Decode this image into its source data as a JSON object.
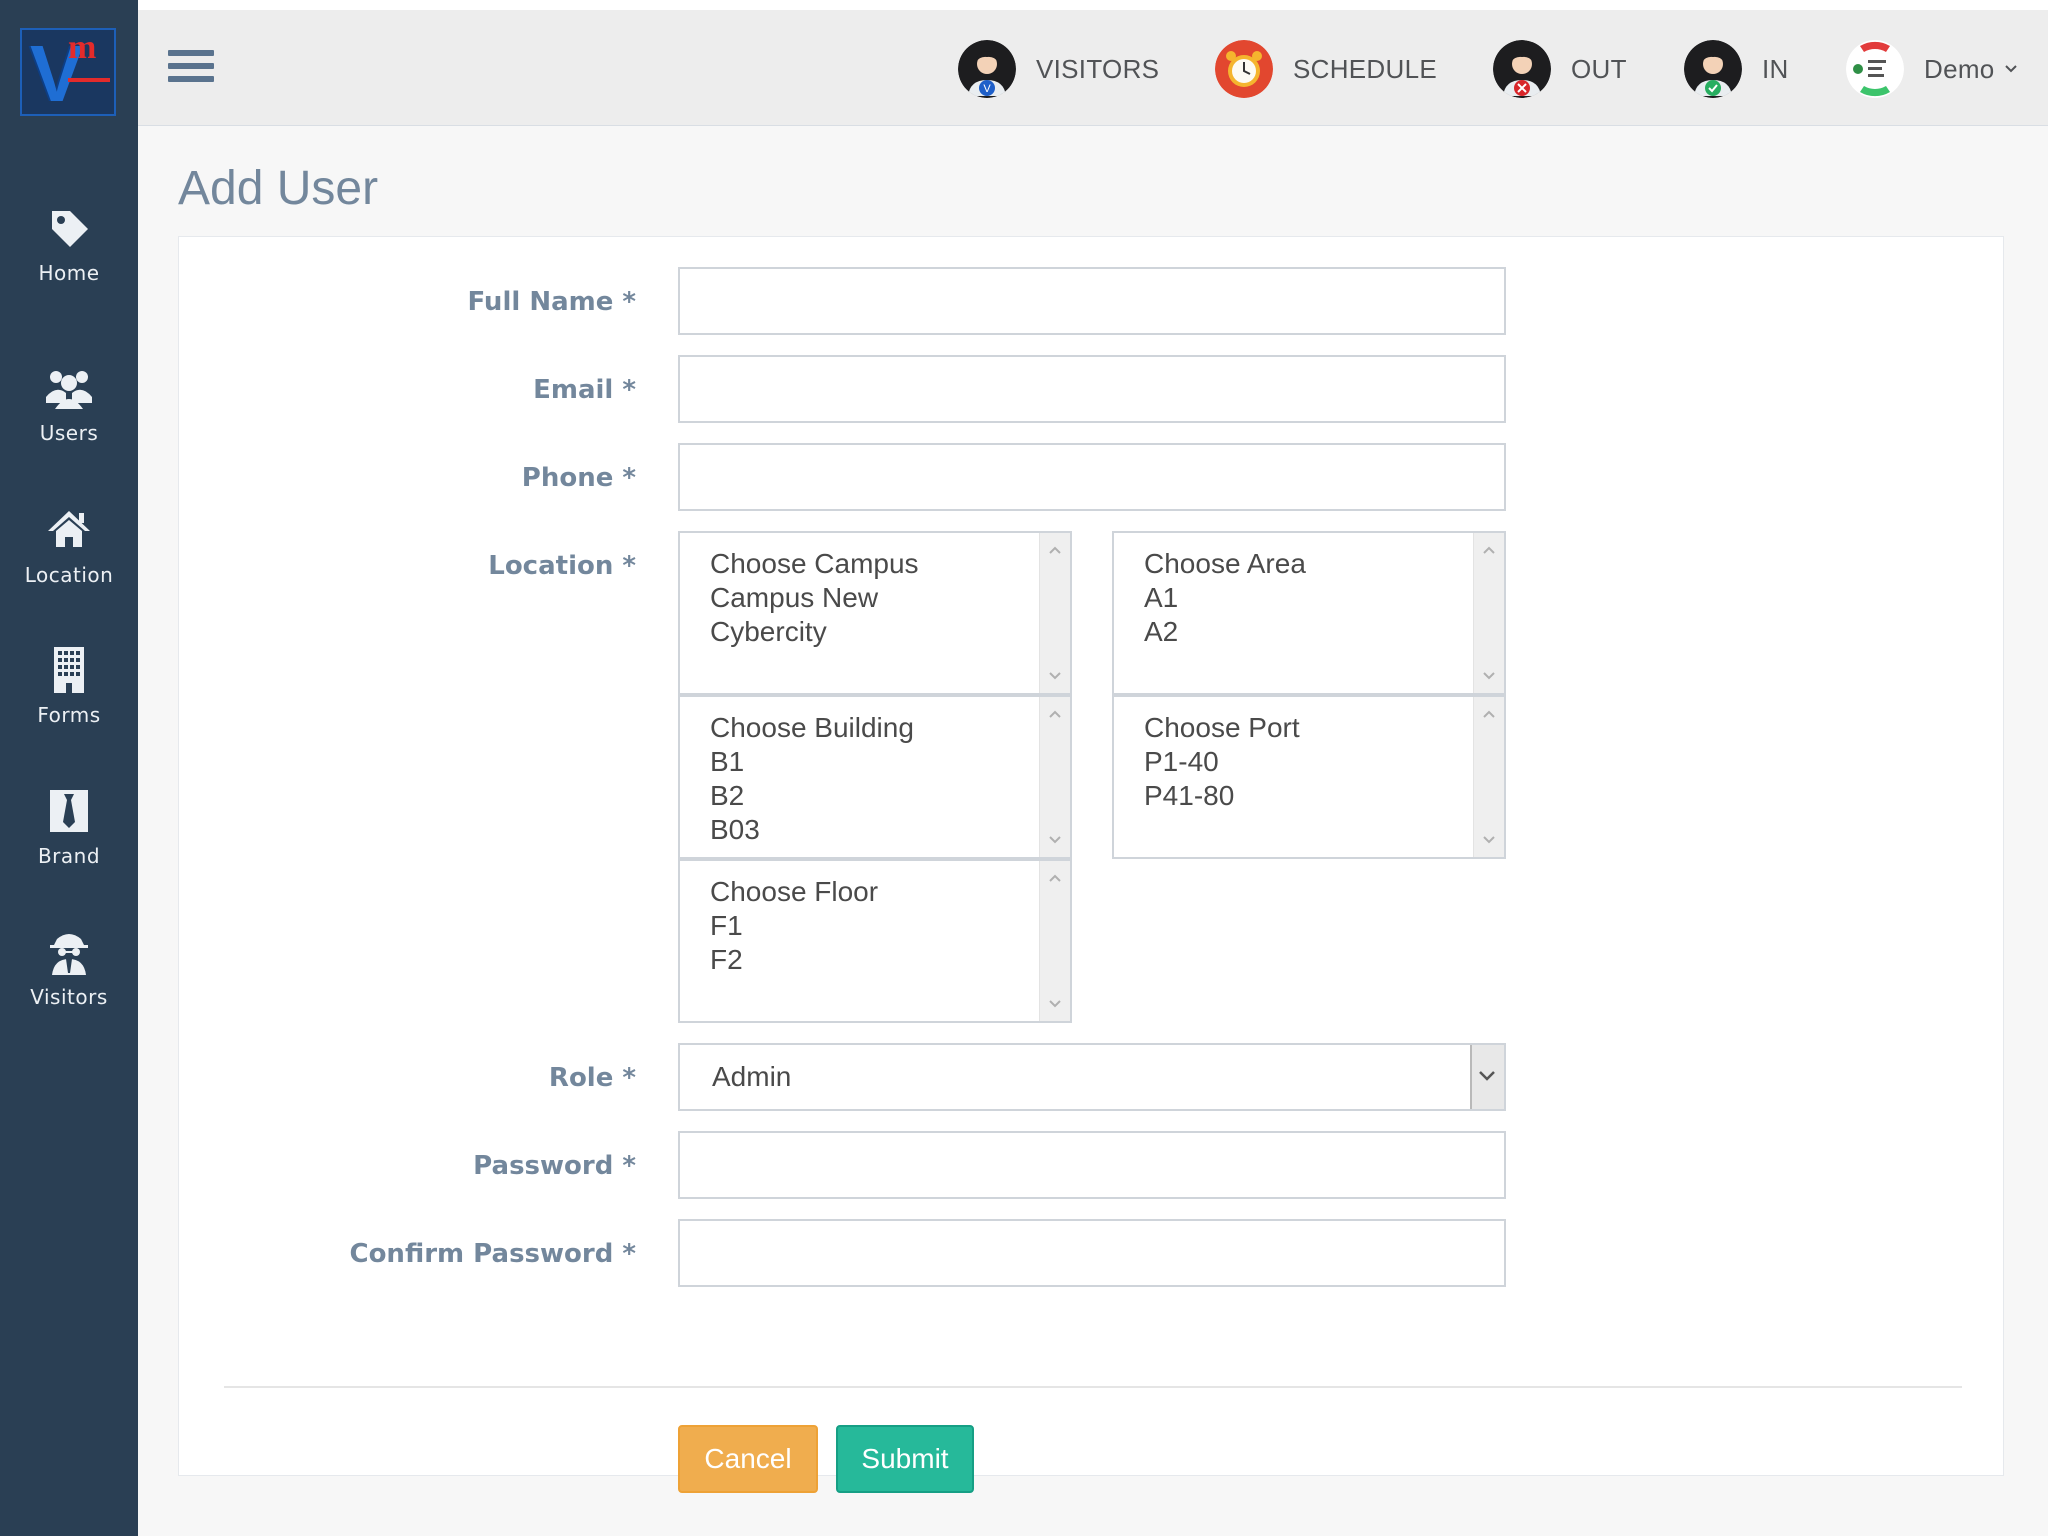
{
  "sidebar": {
    "logo_text": "V",
    "logo_superscript": "m",
    "items": [
      {
        "label": "Home",
        "icon": "tag-icon"
      },
      {
        "label": "Users",
        "icon": "users-icon"
      },
      {
        "label": "Location",
        "icon": "home-icon"
      },
      {
        "label": "Forms",
        "icon": "building-icon"
      },
      {
        "label": "Brand",
        "icon": "tie-icon"
      },
      {
        "label": "Visitors",
        "icon": "spy-icon"
      }
    ]
  },
  "topbar": {
    "items": [
      {
        "label": "VISITORS",
        "icon": "visitor-avatar-icon"
      },
      {
        "label": "SCHEDULE",
        "icon": "alarm-clock-icon"
      },
      {
        "label": "OUT",
        "icon": "checkout-avatar-icon"
      },
      {
        "label": "IN",
        "icon": "checkin-avatar-icon"
      }
    ],
    "user": {
      "label": "Demo",
      "icon": "user-avatar-icon"
    }
  },
  "page": {
    "title": "Add User"
  },
  "form": {
    "labels": {
      "full_name": "Full Name *",
      "email": "Email *",
      "phone": "Phone *",
      "location": "Location *",
      "role": "Role *",
      "password": "Password *",
      "confirm_password": "Confirm Password *"
    },
    "values": {
      "full_name": "",
      "email": "",
      "phone": "",
      "password": "",
      "confirm_password": ""
    },
    "location": {
      "campus": [
        "Choose Campus",
        "Campus New",
        "Cybercity"
      ],
      "area": [
        "Choose Area",
        "A1",
        "A2"
      ],
      "building": [
        "Choose Building",
        "B1",
        "B2",
        "B03"
      ],
      "port": [
        "Choose Port",
        "P1-40",
        "P41-80"
      ],
      "floor": [
        "Choose Floor",
        "F1",
        "F2"
      ]
    },
    "role": {
      "selected": "Admin"
    },
    "buttons": {
      "cancel": "Cancel",
      "submit": "Submit"
    }
  },
  "colors": {
    "sidebar_bg": "#2a3f54",
    "label_text": "#73879c",
    "cancel": "#f0ad4e",
    "submit": "#26b99a"
  }
}
